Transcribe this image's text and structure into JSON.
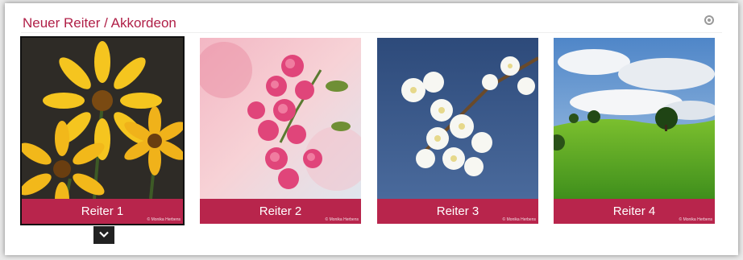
{
  "section": {
    "title": "Neuer Reiter / Akkordeon"
  },
  "icons": {
    "settings": "gear-icon",
    "expand": "chevron-down-icon"
  },
  "colors": {
    "accent": "#b8254c",
    "title": "#b01f47"
  },
  "tabs": [
    {
      "label": "Reiter 1",
      "credit": "© Monika Herbens",
      "image": "yellow-flowers",
      "active": true
    },
    {
      "label": "Reiter 2",
      "credit": "© Monika Herbens",
      "image": "pink-blossoms",
      "active": false
    },
    {
      "label": "Reiter 3",
      "credit": "© Monika Herbens",
      "image": "white-cherry-blossoms",
      "active": false
    },
    {
      "label": "Reiter 4",
      "credit": "© Monika Herbens",
      "image": "green-meadow",
      "active": false
    }
  ]
}
